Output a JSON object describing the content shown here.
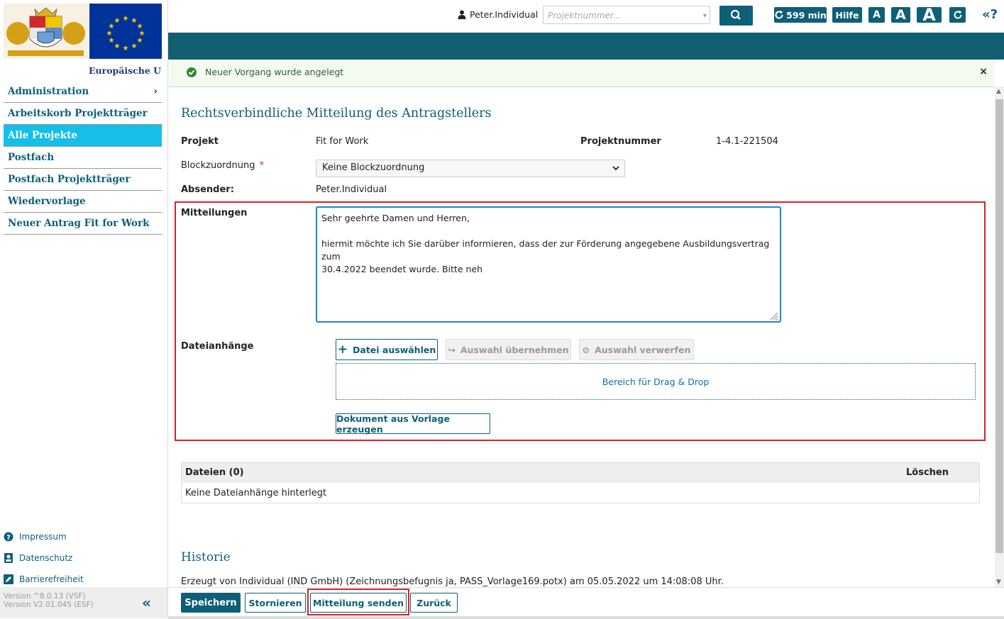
{
  "sidebar": {
    "eu_label": "Europäische Union",
    "nav": [
      {
        "label": "Administration",
        "chevron": "›"
      },
      {
        "label": "Arbeitskorb Projektträger"
      },
      {
        "label": "Alle Projekte",
        "active": true
      },
      {
        "label": "Postfach"
      },
      {
        "label": "Postfach Projektträger"
      },
      {
        "label": "Wiedervorlage"
      },
      {
        "label": "Neuer Antrag Fit for Work"
      }
    ],
    "links": {
      "impressum": "Impressum",
      "datenschutz": "Datenschutz",
      "barrierefreiheit": "Barrierefreiheit"
    },
    "version_1": "Version ^8.0.13 (VSF)",
    "version_2": "Version V2.01.045 (ESF)",
    "collapse_icon": "«"
  },
  "topbar": {
    "user": "Peter.Individual",
    "search_placeholder": "Projektnummer...",
    "timer": "599 min",
    "help": "Hilfe",
    "font_small": "A",
    "font_medium": "A",
    "font_large": "A",
    "expand_icon": "«?"
  },
  "success": {
    "message": "Neuer Vorgang wurde angelegt",
    "close": "×"
  },
  "form": {
    "title": "Rechtsverbindliche Mitteilung des Antragstellers",
    "projekt_label": "Projekt",
    "projekt_value": "Fit for Work",
    "projektnummer_label": "Projektnummer",
    "projektnummer_value": "1-4.1-221504",
    "block_label": "Blockzuordnung",
    "required_marker": "*",
    "block_value": "Keine Blockzuordnung",
    "absender_label": "Absender:",
    "absender_value": "Peter.Individual",
    "mitteilungen_label": "Mitteilungen",
    "message_text": "Sehr geehrte Damen und Herren,\n\nhiermit möchte ich Sie darüber informieren, dass der zur Förderung angegebene Ausbildungsvertrag zum\n30.4.2022 beendet wurde. Bitte neh",
    "attachments_label": "Dateianhänge",
    "btn_choose": "Datei auswählen",
    "btn_accept": "Auswahl übernehmen",
    "btn_discard": "Auswahl verwerfen",
    "dropzone": "Bereich für Drag & Drop",
    "btn_template": "Dokument aus Vorlage erzeugen"
  },
  "files": {
    "header_files": "Dateien (0)",
    "header_delete": "Löschen",
    "empty": "Keine Dateianhänge hinterlegt"
  },
  "history": {
    "title": "Historie",
    "entry": "Erzeugt von Individual (IND GmbH) (Zeichnungsbefugnis ja, PASS_Vorlage169.potx) am 05.05.2022 um 14:08:08 Uhr."
  },
  "footer": {
    "save": "Speichern",
    "cancel": "Stornieren",
    "send": "Mitteilung senden",
    "back": "Zurück"
  },
  "colors": {
    "brand": "#0e5f78",
    "active_nav": "#15bfe8",
    "highlight": "#d9202a"
  }
}
